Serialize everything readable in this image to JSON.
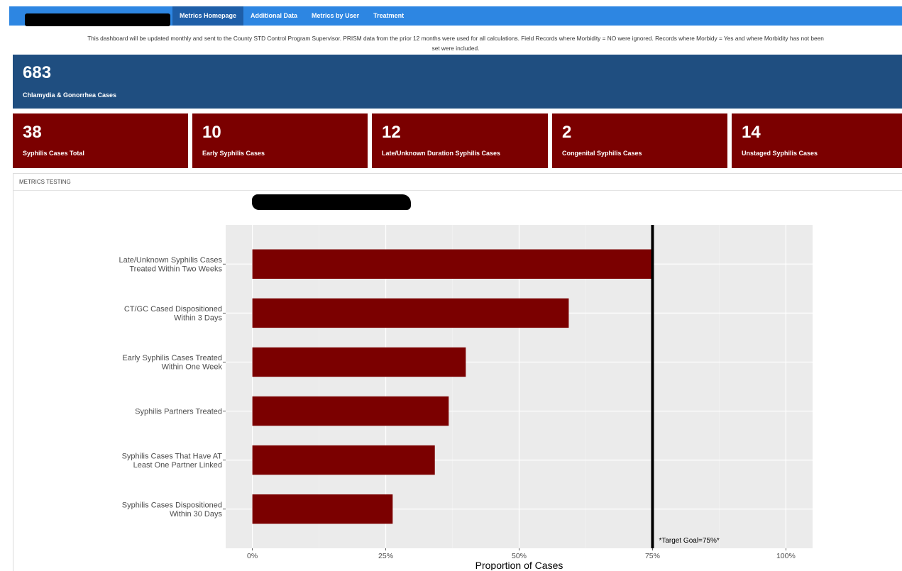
{
  "nav": {
    "tabs": [
      {
        "label": "Metrics Homepage",
        "active": true
      },
      {
        "label": "Additional Data",
        "active": false
      },
      {
        "label": "Metrics by User",
        "active": false
      },
      {
        "label": "Treatment",
        "active": false
      }
    ]
  },
  "notice": {
    "line1": "This dashboard will be updated monthly and sent to the County STD Control Program Supervisor. PRISM data from the prior 12 months were used for all calculations. Field Records where Morbidity = NO were ignored. Records where Morbidy = Yes and where Morbidity has not been",
    "line2": "set were included."
  },
  "summary": {
    "value": "683",
    "label": "Chlamydia & Gonorrhea Cases"
  },
  "cards": [
    {
      "value": "38",
      "label": "Syphilis Cases Total"
    },
    {
      "value": "10",
      "label": "Early Syphilis Cases"
    },
    {
      "value": "12",
      "label": "Late/Unknown Duration Syphilis Cases"
    },
    {
      "value": "2",
      "label": "Congenital Syphilis Cases"
    },
    {
      "value": "14",
      "label": "Unstaged Syphilis Cases"
    }
  ],
  "panel": {
    "title": "METRICS TESTING"
  },
  "colors": {
    "nav_bar": "#2d86e2",
    "nav_active": "#1e5ea8",
    "summary_box": "#1f4e80",
    "card_box": "#7b0000",
    "bar": "#7b0000",
    "plot_bg": "#ebebeb"
  },
  "chart_data": {
    "type": "bar",
    "orientation": "horizontal",
    "categories": [
      "Late/Unknown Syphilis Cases\nTreated Within Two Weeks",
      "CT/GC Cased Dispositioned\nWithin 3 Days",
      "Early Syphilis Cases Treated\nWithin One Week",
      "Syphilis Partners Treated",
      "Syphilis Cases That Have AT\nLeast One Partner Linked",
      "Syphilis Cases Dispositioned\nWithin 30 Days"
    ],
    "values": [
      0.75,
      0.593,
      0.4,
      0.368,
      0.342,
      0.263
    ],
    "xlabel": "Proportion of Cases",
    "ylabel": "",
    "xlim": [
      -0.05,
      1.05
    ],
    "xticks": [
      0,
      0.25,
      0.5,
      0.75,
      1.0
    ],
    "xtick_labels": [
      "0%",
      "25%",
      "50%",
      "75%",
      "100%"
    ],
    "target": {
      "value": 0.75,
      "label": "*Target Goal=75%*"
    },
    "grid": true
  }
}
